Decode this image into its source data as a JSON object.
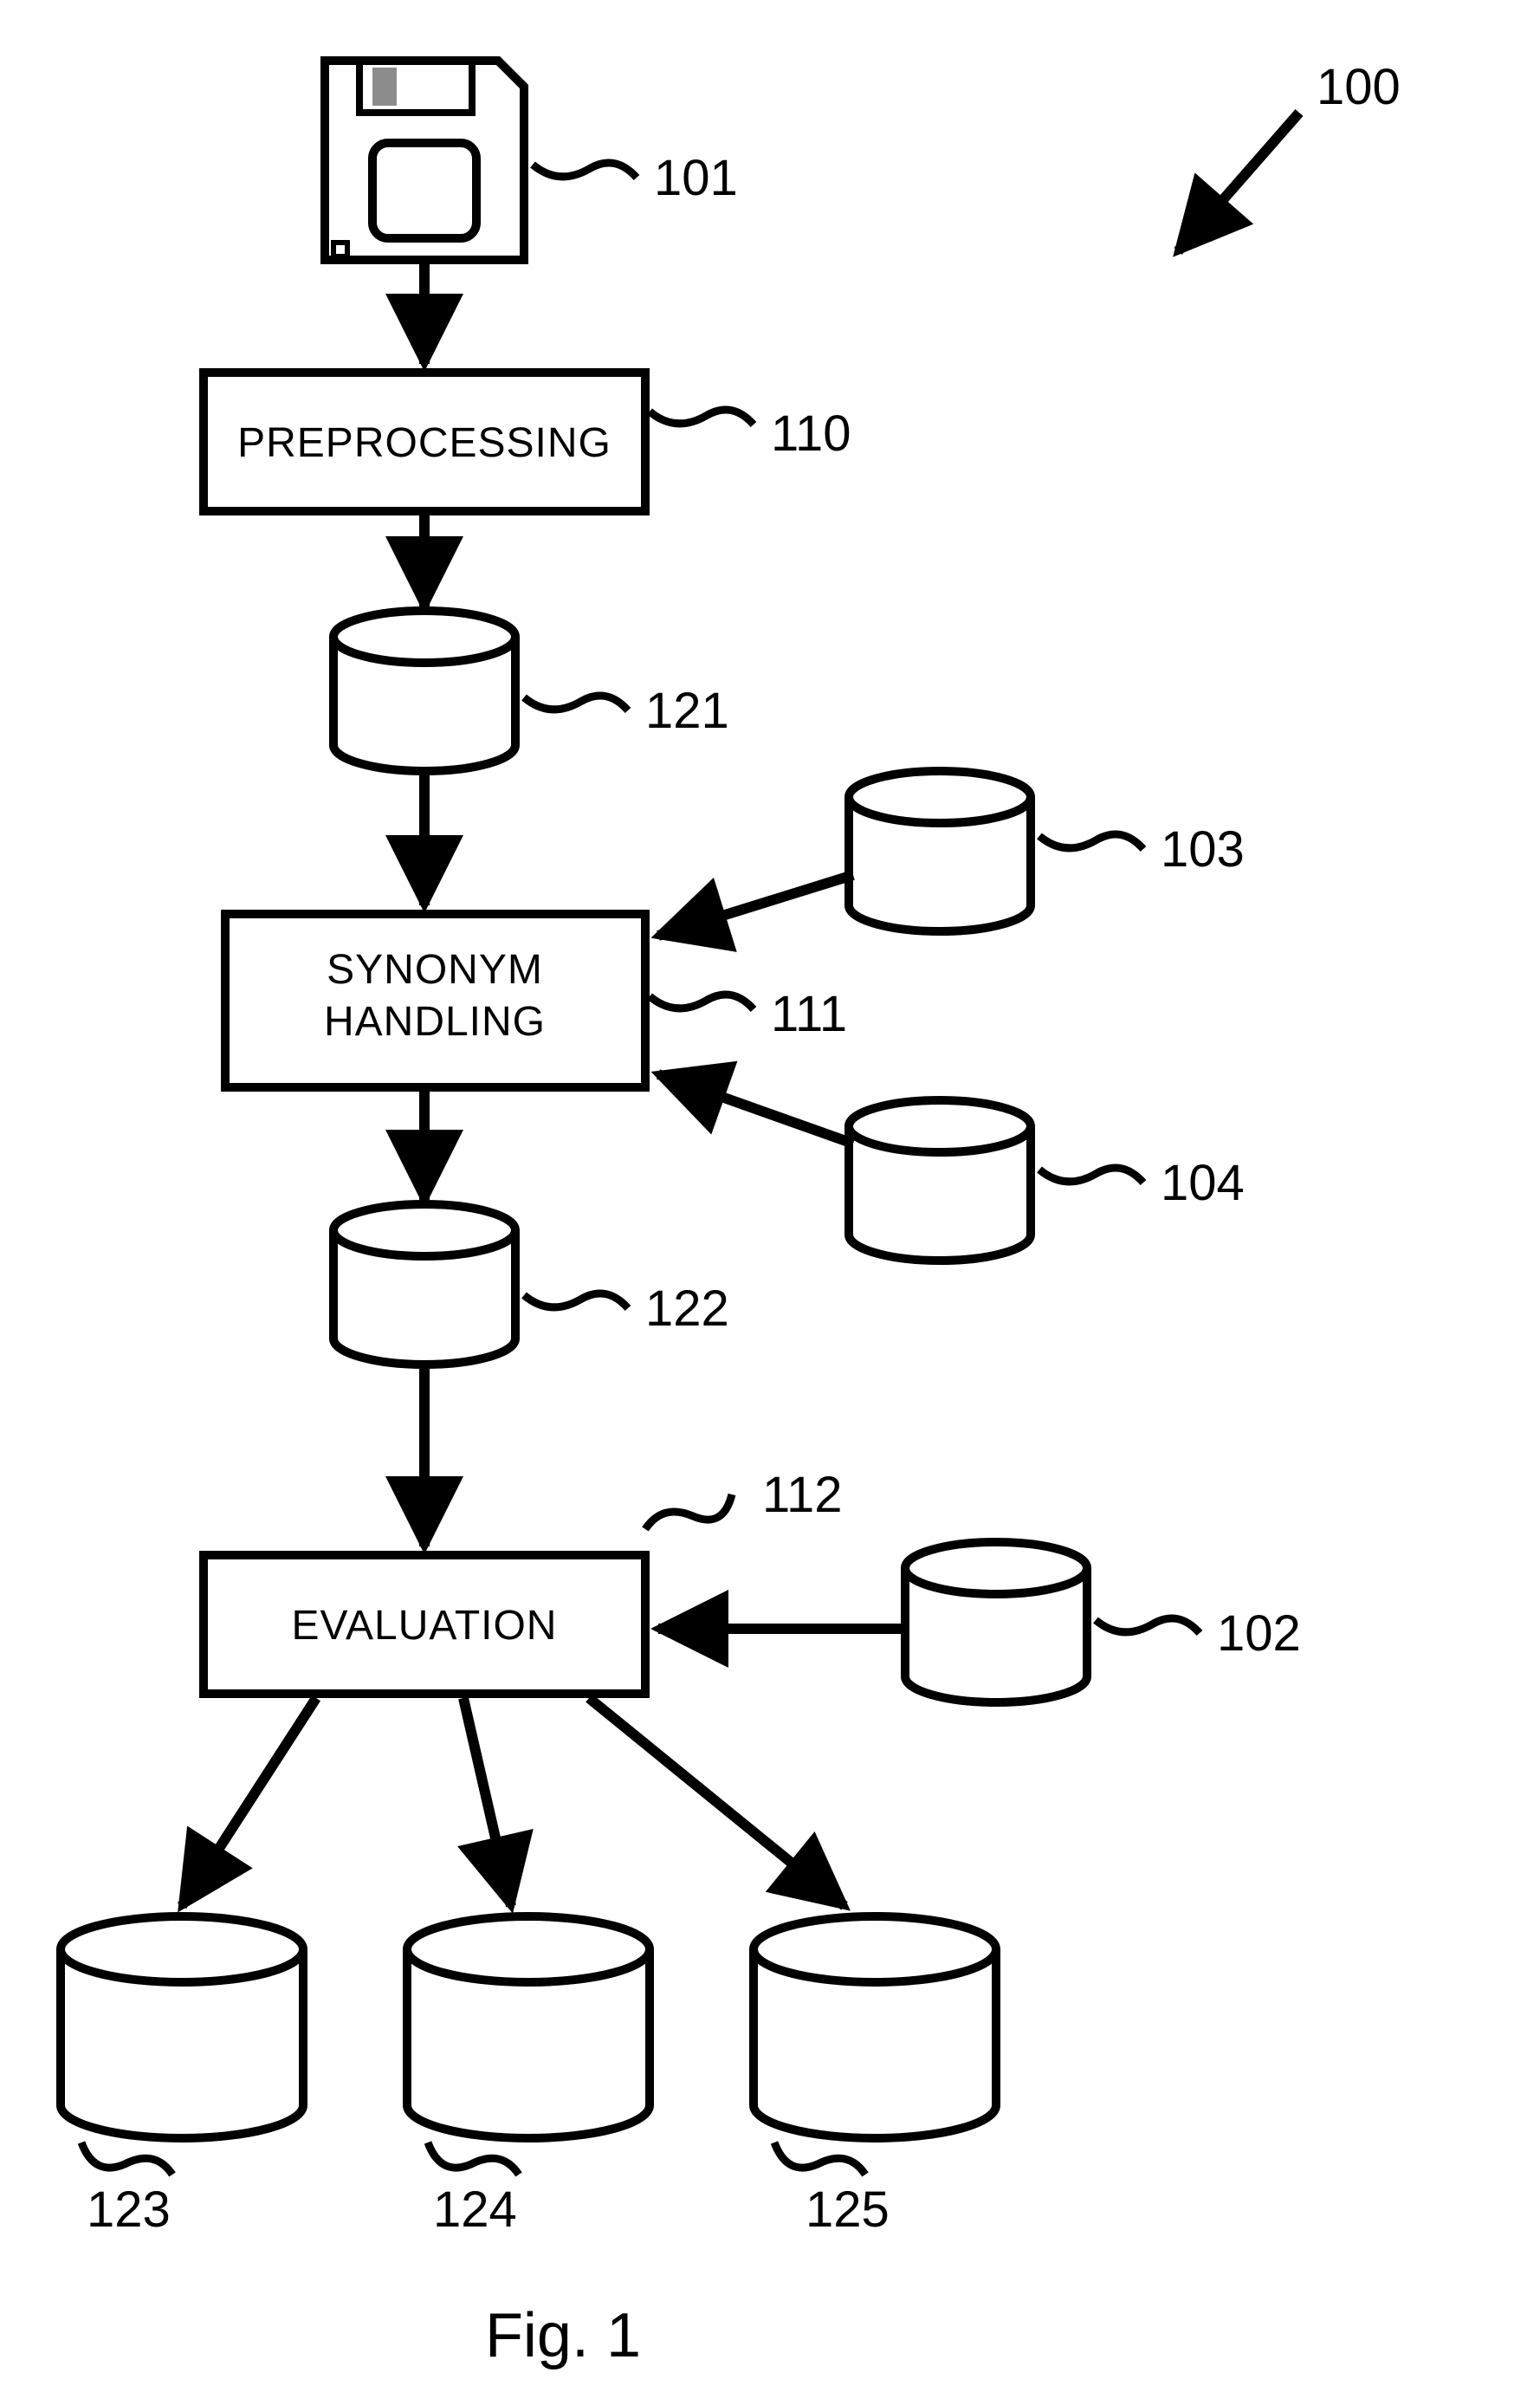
{
  "title_ref": "100",
  "figure_caption": "Fig. 1",
  "blocks": {
    "preprocessing": "PREPROCESSING",
    "synonym_line1": "SYNONYM",
    "synonym_line2": "HANDLING",
    "evaluation": "EVALUATION"
  },
  "refs": {
    "floppy": "101",
    "preprocessing": "110",
    "db_after_pre": "121",
    "db_top_right": "103",
    "synonym": "111",
    "db_mid_right": "104",
    "db_after_syn": "122",
    "evaluation_top": "112",
    "db_eval_right": "102",
    "db_out_left": "123",
    "db_out_mid": "124",
    "db_out_right": "125"
  }
}
